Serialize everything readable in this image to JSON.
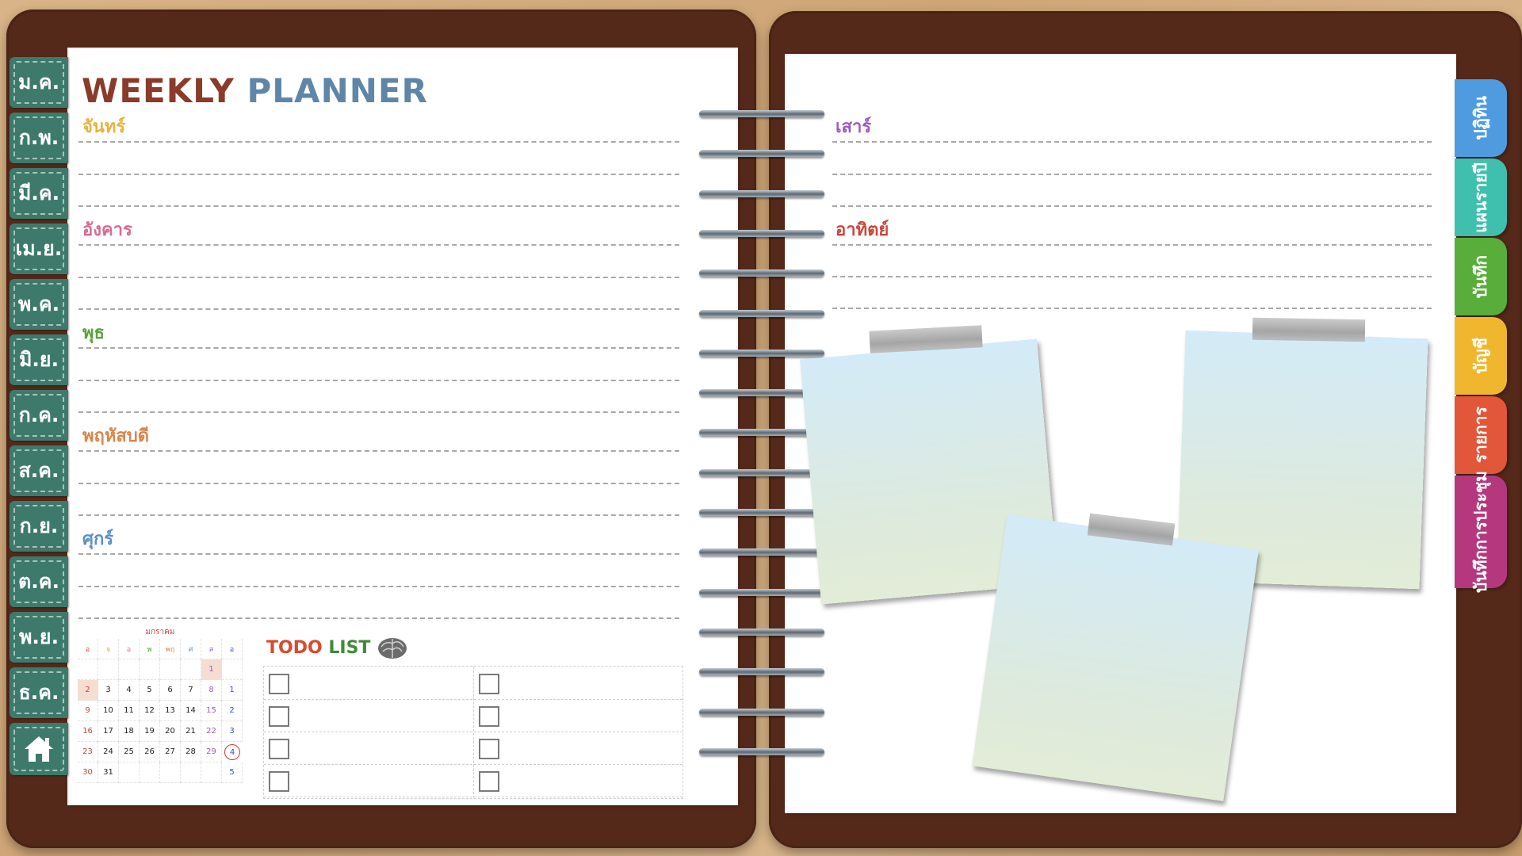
{
  "title": {
    "weekly": "WEEKLY",
    "planner": "PLANNER"
  },
  "months": [
    "ม.ค.",
    "ก.พ.",
    "มี.ค.",
    "เม.ย.",
    "พ.ค.",
    "มิ.ย.",
    "ก.ค.",
    "ส.ค.",
    "ก.ย.",
    "ต.ค.",
    "พ.ย.",
    "ธ.ค."
  ],
  "home_icon": "home-icon",
  "days": {
    "mon": "จันทร์",
    "tue": "อังคาร",
    "wed": "พุธ",
    "thu": "พฤหัสบดี",
    "fri": "ศุกร์",
    "sat": "เสาร์",
    "sun": "อาทิตย์"
  },
  "side_tabs": [
    "ปฏิทิน",
    "แผนรายปี",
    "บันทึก",
    "บัญชี",
    "รายการ",
    "บันทึกการประชุม"
  ],
  "colors": {
    "month_tab": "#3d7a6c",
    "side_tabs": [
      "#4f9be0",
      "#3fbfae",
      "#59ad3a",
      "#f0b62d",
      "#e2563a",
      "#b5387e"
    ],
    "days": {
      "mon": "#e8b23a",
      "tue": "#d9698f",
      "wed": "#59a33a",
      "thu": "#d9854a",
      "fri": "#5b8fc9",
      "sat": "#9a5bbf",
      "sun": "#c8473b"
    }
  },
  "calendar": {
    "title": "มกราคม",
    "headers": [
      "อ",
      "จ",
      "อ",
      "พ",
      "พฤ",
      "ศ",
      "ส",
      "อ"
    ],
    "weeks": [
      [
        "",
        "",
        "",
        "",
        "",
        "",
        "1",
        ""
      ],
      [
        "2",
        "3",
        "4",
        "5",
        "6",
        "7",
        "8",
        "1"
      ],
      [
        "9",
        "10",
        "11",
        "12",
        "13",
        "14",
        "15",
        "2"
      ],
      [
        "16",
        "17",
        "18",
        "19",
        "20",
        "21",
        "22",
        "3"
      ],
      [
        "23",
        "24",
        "25",
        "26",
        "27",
        "28",
        "29",
        "4"
      ],
      [
        "30",
        "31",
        "",
        "",
        "",
        "",
        "",
        "5"
      ]
    ]
  },
  "todo": {
    "label_todo": "TODO",
    "label_list": "LIST",
    "icon": "brain-icon"
  }
}
